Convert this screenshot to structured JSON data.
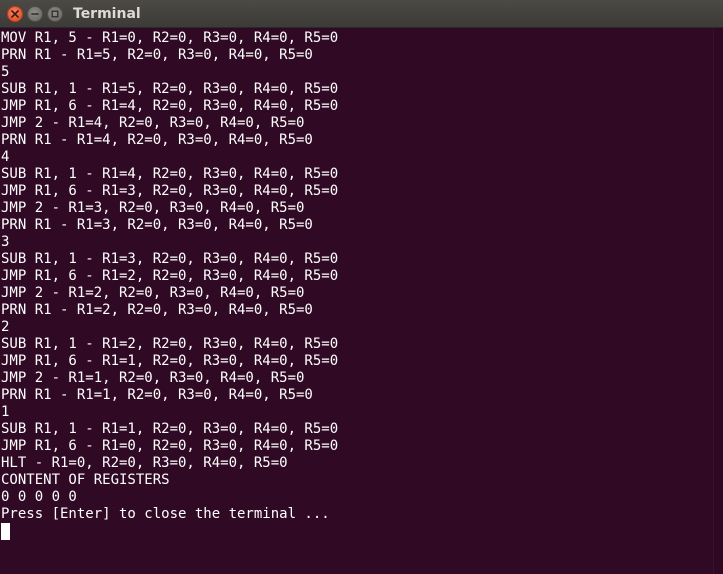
{
  "window": {
    "title": "Terminal"
  },
  "colors": {
    "terminal_background": "#300a24",
    "terminal_text": "#ffffff",
    "titlebar": "#3c3b37",
    "close_button": "#e2562c"
  },
  "icons": {
    "close": "close-icon",
    "minimize": "minimize-icon",
    "maximize": "maximize-icon"
  },
  "terminal": {
    "lines": [
      "MOV R1, 5 - R1=0, R2=0, R3=0, R4=0, R5=0",
      "PRN R1 - R1=5, R2=0, R3=0, R4=0, R5=0",
      "5",
      "SUB R1, 1 - R1=5, R2=0, R3=0, R4=0, R5=0",
      "JMP R1, 6 - R1=4, R2=0, R3=0, R4=0, R5=0",
      "JMP 2 - R1=4, R2=0, R3=0, R4=0, R5=0",
      "PRN R1 - R1=4, R2=0, R3=0, R4=0, R5=0",
      "4",
      "SUB R1, 1 - R1=4, R2=0, R3=0, R4=0, R5=0",
      "JMP R1, 6 - R1=3, R2=0, R3=0, R4=0, R5=0",
      "JMP 2 - R1=3, R2=0, R3=0, R4=0, R5=0",
      "PRN R1 - R1=3, R2=0, R3=0, R4=0, R5=0",
      "3",
      "SUB R1, 1 - R1=3, R2=0, R3=0, R4=0, R5=0",
      "JMP R1, 6 - R1=2, R2=0, R3=0, R4=0, R5=0",
      "JMP 2 - R1=2, R2=0, R3=0, R4=0, R5=0",
      "PRN R1 - R1=2, R2=0, R3=0, R4=0, R5=0",
      "2",
      "SUB R1, 1 - R1=2, R2=0, R3=0, R4=0, R5=0",
      "JMP R1, 6 - R1=1, R2=0, R3=0, R4=0, R5=0",
      "JMP 2 - R1=1, R2=0, R3=0, R4=0, R5=0",
      "PRN R1 - R1=1, R2=0, R3=0, R4=0, R5=0",
      "1",
      "SUB R1, 1 - R1=1, R2=0, R3=0, R4=0, R5=0",
      "JMP R1, 6 - R1=0, R2=0, R3=0, R4=0, R5=0",
      "HLT - R1=0, R2=0, R3=0, R4=0, R5=0",
      "CONTENT OF REGISTERS",
      "0 0 0 0 0",
      "Press [Enter] to close the terminal ..."
    ]
  }
}
